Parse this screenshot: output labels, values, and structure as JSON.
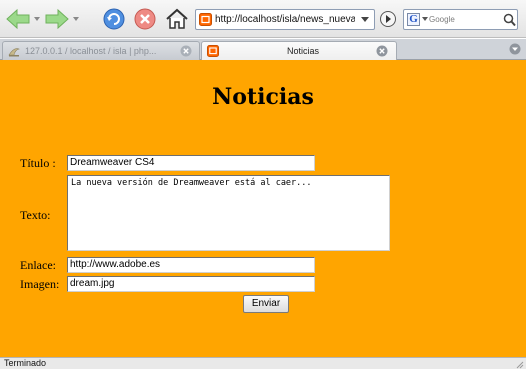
{
  "toolbar": {
    "url": "http://localhost/isla/news_nueva.php",
    "search_engine_letter": "G",
    "search_placeholder": "Google"
  },
  "tabs": [
    {
      "label": "127.0.0.1 / localhost / isla | php...",
      "active": false
    },
    {
      "label": "Noticias",
      "active": true
    }
  ],
  "page": {
    "title": "Noticias",
    "form": {
      "titulo_label": "Título :",
      "titulo_value": "Dreamweaver CS4",
      "texto_label": "Texto:",
      "texto_value": "La nueva versión de Dreamweaver está al caer...",
      "enlace_label": "Enlace:",
      "enlace_value": "http://www.adobe.es",
      "imagen_label": "Imagen:",
      "imagen_value": "dream.jpg",
      "submit_label": "Enviar"
    },
    "background_color": "#ffa500"
  },
  "status": {
    "text": "Terminado"
  },
  "colors": {
    "page_background": "#ffa500",
    "tab_favicon": "#ff6600",
    "back_forward_arrow": "#8fd07a",
    "reload_icon": "#3a7bd5",
    "stop_icon": "#e0554b"
  }
}
